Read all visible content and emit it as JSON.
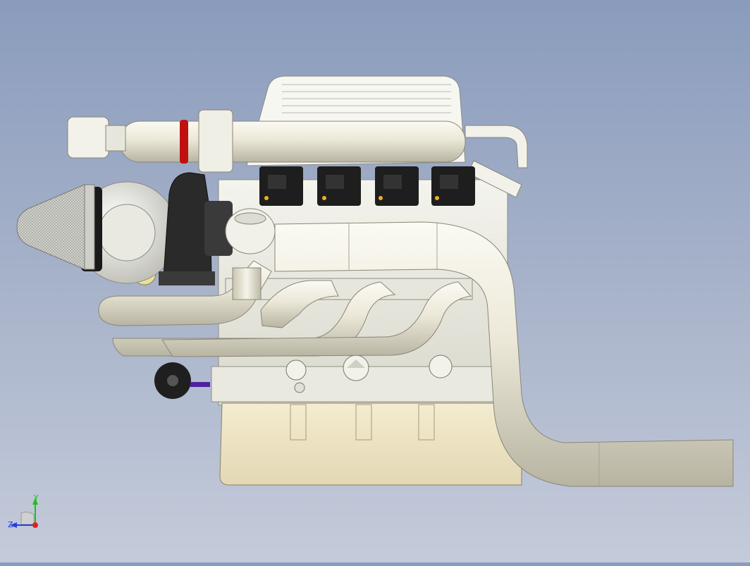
{
  "viewport": {
    "background_top": "#8a9cbd",
    "background_bottom": "#c4cbda",
    "model": {
      "pipe_color": "#e8e4d2",
      "pan_color": "#efe6c8",
      "coil_color": "#1a1a1a",
      "accent_red": "#c01010",
      "turbo_housing": "#2a2a2a"
    }
  },
  "triad": {
    "y_label": "Y",
    "z_label": "Z",
    "y_color": "#20c020",
    "z_color": "#2040e0",
    "x_color": "#e02020"
  }
}
